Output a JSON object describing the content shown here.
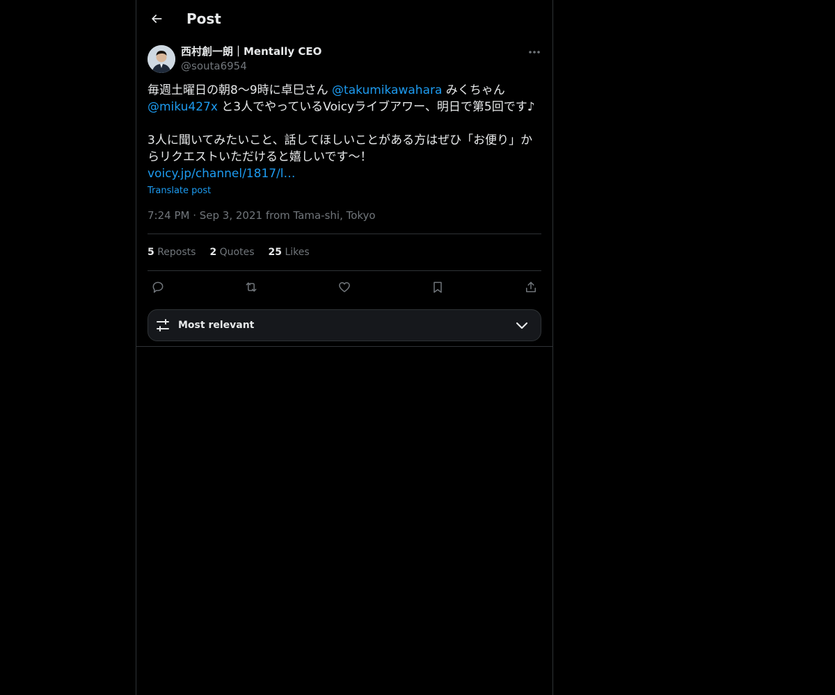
{
  "header": {
    "title": "Post",
    "back_icon": "arrow-left-icon"
  },
  "author": {
    "display_name": "西村創一朗｜Mentally CEO",
    "handle": "@souta6954",
    "avatar": "avatar-photo",
    "more_icon": "ellipsis-icon"
  },
  "post": {
    "line1_a": "毎週土曜日の朝8〜9時に卓巳さん ",
    "mention1": "@takumikawahara",
    "line1_b": " みくちゃん",
    "mention2": "@miku427x",
    "line2_b": " と3人でやっているVoicyライブアワー、明日で第5回です♪",
    "para2": "3人に聞いてみたいこと、話してほしいことがある方はぜひ「お便り」からリクエストいただけると嬉しいです〜！",
    "url": "voicy.jp/channel/1817/l…",
    "translate": "Translate post",
    "time": "7:24 PM",
    "sep": " · ",
    "date_location": "Sep 3, 2021 from Tama-shi, Tokyo"
  },
  "stats": {
    "reposts_count": "5",
    "reposts_label": "Reposts",
    "quotes_count": "2",
    "quotes_label": "Quotes",
    "likes_count": "25",
    "likes_label": "Likes"
  },
  "actions": [
    "reply-icon",
    "repost-icon",
    "like-icon",
    "bookmark-icon",
    "share-icon"
  ],
  "sort": {
    "label": "Most relevant",
    "icon": "sliders-icon",
    "chevron": "chevron-down-icon"
  },
  "colors": {
    "background": "#000000",
    "text": "#e7e9ea",
    "muted": "#71767b",
    "link": "#1d9bf0",
    "border": "#2f3336"
  }
}
